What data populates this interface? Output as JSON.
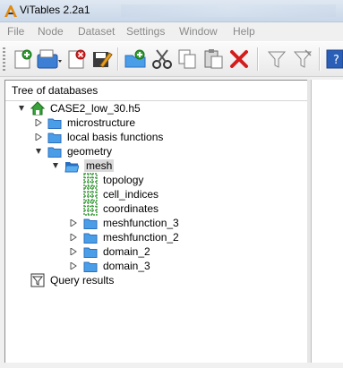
{
  "window": {
    "title": "ViTables 2.2a1"
  },
  "menu": [
    "File",
    "Node",
    "Dataset",
    "Settings",
    "Window",
    "Help"
  ],
  "toolbar": {
    "buttons": [
      "new-file",
      "open-file",
      "close-file",
      "save-as",
      "new-group",
      "cut",
      "copy",
      "paste",
      "delete",
      "filter",
      "filter-clear",
      "help"
    ]
  },
  "tree": {
    "header": "Tree of databases",
    "nodes": [
      {
        "label": "CASE2_low_30.h5",
        "icon": "home-icon",
        "expanded": true
      },
      {
        "label": "microstructure",
        "icon": "folder-icon",
        "expanded": false
      },
      {
        "label": "local basis functions",
        "icon": "folder-icon",
        "expanded": false
      },
      {
        "label": "geometry",
        "icon": "folder-icon",
        "expanded": true
      },
      {
        "label": "mesh",
        "icon": "folder-open-icon",
        "expanded": true,
        "selected": true
      },
      {
        "label": "topology",
        "icon": "dataset-icon"
      },
      {
        "label": "cell_indices",
        "icon": "dataset-icon"
      },
      {
        "label": "coordinates",
        "icon": "dataset-icon"
      },
      {
        "label": "meshfunction_3",
        "icon": "folder-icon",
        "expanded": false
      },
      {
        "label": "meshfunction_2",
        "icon": "folder-icon",
        "expanded": false
      },
      {
        "label": "domain_2",
        "icon": "folder-icon",
        "expanded": false
      },
      {
        "label": "domain_3",
        "icon": "folder-icon",
        "expanded": false
      },
      {
        "label": "Query results",
        "icon": "query-results-icon"
      }
    ]
  },
  "colors": {
    "folder": "#4a9ee8",
    "folder_dark": "#2a6fbf",
    "dataset_grid": "#3a9a3a",
    "home": "#3aa23a",
    "menu_text": "#8a8a8a"
  }
}
